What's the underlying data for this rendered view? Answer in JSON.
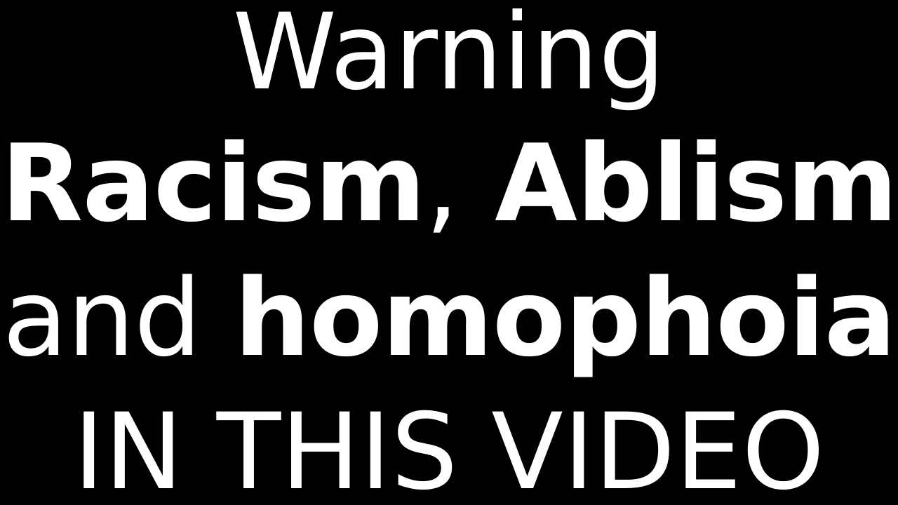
{
  "warning": {
    "heading": "Warning",
    "line2": {
      "term1": "Racism",
      "separator": ",",
      "term2": "Ablism"
    },
    "line3": {
      "connector": "and",
      "term3": "homophoia"
    },
    "footer": "IN THIS VIDEO"
  },
  "colors": {
    "background": "#000000",
    "text": "#ffffff"
  }
}
